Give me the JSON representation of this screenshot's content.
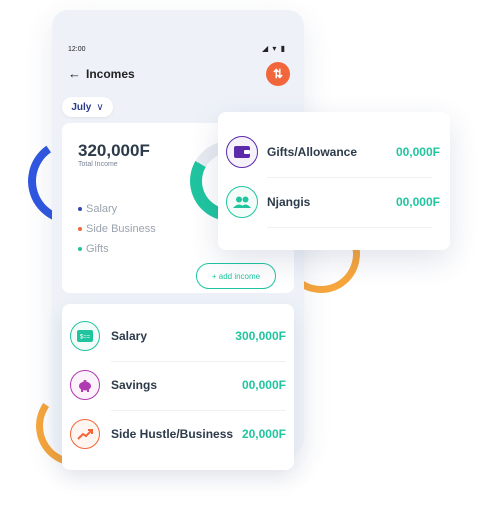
{
  "status": {
    "time": "12:00",
    "icons": "◢ ▾ ▮"
  },
  "header": {
    "back_icon": "←",
    "title": "Incomes",
    "swap_icon": "⇅"
  },
  "month_selector": {
    "value": "July",
    "chevron": "∨"
  },
  "summary": {
    "total_amount": "320,000F",
    "total_label": "Total Income",
    "legend": [
      {
        "label": "Salary",
        "color": "#2f49b7"
      },
      {
        "label": "Side Business",
        "color": "#f2663b"
      },
      {
        "label": "Gifts",
        "color": "#20c5a0"
      }
    ],
    "add_button": "+ add income"
  },
  "incomes": [
    {
      "name": "Salary",
      "amount": "300,000F",
      "icon": "salary-icon",
      "color": "#20c5a0"
    },
    {
      "name": "Savings",
      "amount": "00,000F",
      "icon": "piggy-bank-icon",
      "color": "#b03bb0"
    },
    {
      "name": "Side Hustle/Business",
      "amount": "20,000F",
      "icon": "trend-up-icon",
      "color": "#f2663b"
    }
  ],
  "floating": [
    {
      "name": "Gifts/Allowance",
      "amount": "00,000F",
      "icon": "wallet-icon",
      "color": "#5a2aa8"
    },
    {
      "name": "Njangis",
      "amount": "00,000F",
      "icon": "group-icon",
      "color": "#20c5a0"
    }
  ]
}
